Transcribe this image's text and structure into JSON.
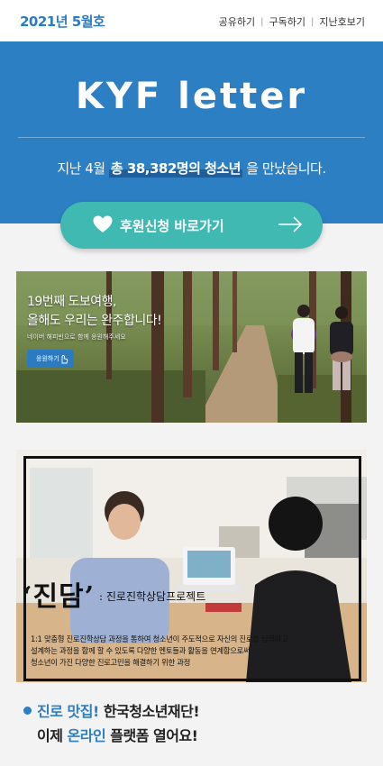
{
  "header": {
    "issue": "2021년 5월호",
    "links": [
      "공유하기",
      "구독하기",
      "지난호보기"
    ]
  },
  "hero": {
    "title": "KYF letter",
    "sub_before": "지난 4월",
    "sub_highlight": "총 38,382명의 청소년",
    "sub_after": "을 만났습니다."
  },
  "donate": {
    "label": "후원신청 바로가기"
  },
  "banner_walk": {
    "title_line1": "19번째 도보여행,",
    "title_line2": "올해도 우리는 완주합니다!",
    "small": "네이버 해피빈으로 함께 응원해주세요",
    "button": "응원하기"
  },
  "banner_jindam": {
    "title": "‘진담’",
    "subtitle": ": 진로진학상담프로젝트",
    "desc_line1": "1:1 맞춤형 진로진학상담 과정을 통하여 청소년이 주도적으로 자신의 진로를 탐색하고",
    "desc_line2": "설계하는 과정을 함께 할 수 있도록 다양한 멘토들과 활동을 연계함으로써",
    "desc_line3": "청소년이 가진 다양한 진로고민을 해결하기 위한 과정"
  },
  "headline": {
    "part1_blue": "진로 맛집!",
    "part1_rest": " 한국청소년재단!",
    "part2_a": "이제 ",
    "part2_blue": "온라인",
    "part2_rest": " 플랫폼 열어요!"
  },
  "colors": {
    "brand_blue": "#2c7fc3",
    "teal": "#3fb9b2",
    "background": "#f3f3f3"
  }
}
